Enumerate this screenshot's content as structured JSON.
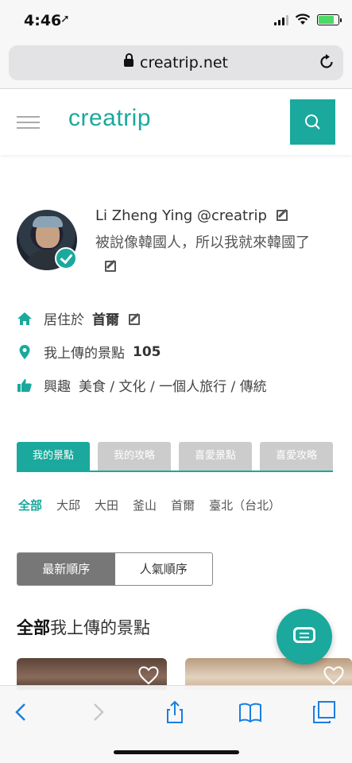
{
  "status_bar": {
    "time": "4:46",
    "location_glyph": "➚"
  },
  "browser": {
    "domain": "creatrip.net",
    "lock_icon": "lock-icon",
    "reload_icon": "reload-icon"
  },
  "header": {
    "logo": "creatrip"
  },
  "profile": {
    "name": "Li Zheng Ying @creatrip",
    "bio": "被說像韓國人，所以我就來韓國了",
    "residence_label": "居住於",
    "residence_value": "首爾",
    "uploads_label": "我上傳的景點",
    "uploads_count": "105",
    "interests_label": "興趣",
    "interests_value": "美食 / 文化 / 一個人旅行 / 傳統"
  },
  "tabs": [
    {
      "label": "我的景點",
      "active": true
    },
    {
      "label": "我的攻略",
      "active": false
    },
    {
      "label": "喜愛景點",
      "active": false
    },
    {
      "label": "喜愛攻略",
      "active": false
    }
  ],
  "cities": [
    "全部",
    "大邱",
    "大田",
    "釜山",
    "首爾",
    "臺北（台北）"
  ],
  "sort": {
    "latest": "最新順序",
    "popular": "人氣順序"
  },
  "section": {
    "prefix": "全部",
    "title": "我上傳的景點"
  },
  "colors": {
    "accent": "#1aa99c"
  }
}
